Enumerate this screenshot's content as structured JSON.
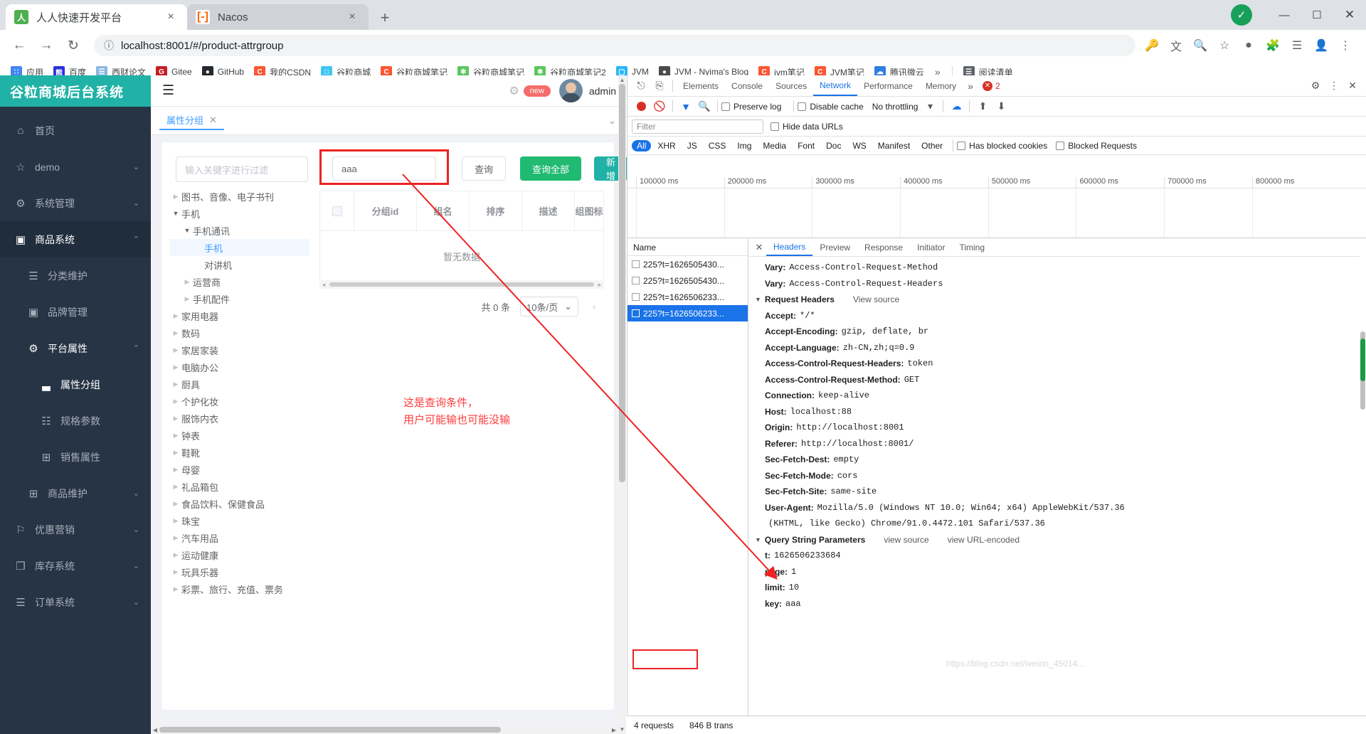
{
  "browser": {
    "tabs": [
      {
        "title": "人人快速开发平台",
        "icon": "renren-favicon",
        "active": true,
        "close": "×"
      },
      {
        "title": "Nacos",
        "icon": "nacos-favicon",
        "active": false,
        "close": "×"
      }
    ],
    "new_tab_label": "+",
    "window_controls": {
      "minimize": "—",
      "maximize": "❐",
      "close": "✕"
    },
    "toolbar": {
      "back": "←",
      "forward": "→",
      "reload": "↻",
      "site_info": "ⓘ",
      "url": "localhost:8001/#/product-attrgroup",
      "actions": [
        "key-icon",
        "translate-icon",
        "search-icon",
        "star-icon",
        "extension-puzzle-icon",
        "profile-icon",
        "menu-icon"
      ]
    },
    "bookmarks": [
      {
        "label": "应用",
        "icon": "apps-grid-icon",
        "color": "#4285f4"
      },
      {
        "label": "百度",
        "icon": "baidu-icon",
        "color": "#2932e1"
      },
      {
        "label": "西财论文",
        "icon": "doc-icon",
        "color": "#8bb7e0"
      },
      {
        "label": "Gitee",
        "icon": "gitee-icon",
        "color": "#c71d23"
      },
      {
        "label": "GitHub",
        "icon": "github-icon",
        "color": "#24292e"
      },
      {
        "label": "我的CSDN",
        "icon": "csdn-icon",
        "color": "#fc5531"
      },
      {
        "label": "谷粒商城",
        "icon": "mall-icon",
        "color": "#3fc5f0"
      },
      {
        "label": "谷粒商城笔记",
        "icon": "csdn-icon",
        "color": "#fc5531"
      },
      {
        "label": "谷粒商城笔记",
        "icon": "leaf-icon",
        "color": "#5cc75c"
      },
      {
        "label": "谷粒商城笔记2",
        "icon": "leaf-icon",
        "color": "#5cc75c"
      },
      {
        "label": "JVM",
        "icon": "robot-icon",
        "color": "#29b6f6"
      },
      {
        "label": "JVM - Nyima's Blog",
        "icon": "globe-icon",
        "color": "#4a4a4a"
      },
      {
        "label": "jvm笔记",
        "icon": "csdn-icon",
        "color": "#fc5531"
      },
      {
        "label": "JVM笔记",
        "icon": "csdn-icon",
        "color": "#fc5531"
      },
      {
        "label": "腾讯微云",
        "icon": "weiyun-icon",
        "color": "#2f7fe0"
      }
    ],
    "overflow_label": "»",
    "reading_list": {
      "label": "阅读清单",
      "icon": "reading-list-icon"
    }
  },
  "admin": {
    "brand": "谷粒商城后台系统",
    "header": {
      "hamburger": "☰",
      "gear": "⚙",
      "new_badge": "new",
      "username": "admin"
    },
    "menu": [
      {
        "label": "首页",
        "icon": "home-icon",
        "level": 1,
        "chevron": "",
        "state": ""
      },
      {
        "label": "demo",
        "icon": "star-icon",
        "level": 1,
        "chevron": "⌄",
        "state": ""
      },
      {
        "label": "系统管理",
        "icon": "gear-icon",
        "level": 1,
        "chevron": "⌄",
        "state": ""
      },
      {
        "label": "商品系统",
        "icon": "box-icon",
        "level": 1,
        "chevron": "⌃",
        "state": "group-open"
      },
      {
        "label": "分类维护",
        "icon": "list-icon",
        "level": 2,
        "chevron": "",
        "state": ""
      },
      {
        "label": "品牌管理",
        "icon": "box-icon",
        "level": 2,
        "chevron": "",
        "state": ""
      },
      {
        "label": "平台属性",
        "icon": "gear-icon",
        "level": 2,
        "chevron": "⌃",
        "state": "active"
      },
      {
        "label": "属性分组",
        "icon": "chart-icon",
        "level": 3,
        "chevron": "",
        "state": "active"
      },
      {
        "label": "规格参数",
        "icon": "file-icon",
        "level": 3,
        "chevron": "",
        "state": ""
      },
      {
        "label": "销售属性",
        "icon": "grid-icon",
        "level": 3,
        "chevron": "",
        "state": ""
      },
      {
        "label": "商品维护",
        "icon": "grid-icon",
        "level": 2,
        "chevron": "⌄",
        "state": ""
      },
      {
        "label": "优惠营销",
        "icon": "coupon-icon",
        "level": 1,
        "chevron": "⌄",
        "state": ""
      },
      {
        "label": "库存系统",
        "icon": "stock-icon",
        "level": 1,
        "chevron": "⌄",
        "state": ""
      },
      {
        "label": "订单系统",
        "icon": "order-icon",
        "level": 1,
        "chevron": "⌄",
        "state": ""
      }
    ],
    "view_tab": {
      "label": "属性分组",
      "close": "✕",
      "collapse": "⌄"
    },
    "tree_filter_placeholder": "输入关键字进行过滤",
    "tree": [
      {
        "label": "图书、音像、电子书刊",
        "level": 1,
        "arrow": "collapsed",
        "selected": false
      },
      {
        "label": "手机",
        "level": 1,
        "arrow": "expanded",
        "selected": false
      },
      {
        "label": "手机通讯",
        "level": 2,
        "arrow": "expanded",
        "selected": false
      },
      {
        "label": "手机",
        "level": 3,
        "arrow": "none",
        "selected": true
      },
      {
        "label": "对讲机",
        "level": 3,
        "arrow": "none",
        "selected": false
      },
      {
        "label": "运营商",
        "level": 2,
        "arrow": "collapsed",
        "selected": false
      },
      {
        "label": "手机配件",
        "level": 2,
        "arrow": "collapsed",
        "selected": false
      },
      {
        "label": "家用电器",
        "level": 1,
        "arrow": "collapsed",
        "selected": false
      },
      {
        "label": "数码",
        "level": 1,
        "arrow": "collapsed",
        "selected": false
      },
      {
        "label": "家居家装",
        "level": 1,
        "arrow": "collapsed",
        "selected": false
      },
      {
        "label": "电脑办公",
        "level": 1,
        "arrow": "collapsed",
        "selected": false
      },
      {
        "label": "厨具",
        "level": 1,
        "arrow": "collapsed",
        "selected": false
      },
      {
        "label": "个护化妆",
        "level": 1,
        "arrow": "collapsed",
        "selected": false
      },
      {
        "label": "服饰内衣",
        "level": 1,
        "arrow": "collapsed",
        "selected": false
      },
      {
        "label": "钟表",
        "level": 1,
        "arrow": "collapsed",
        "selected": false
      },
      {
        "label": "鞋靴",
        "level": 1,
        "arrow": "collapsed",
        "selected": false
      },
      {
        "label": "母婴",
        "level": 1,
        "arrow": "collapsed",
        "selected": false
      },
      {
        "label": "礼品箱包",
        "level": 1,
        "arrow": "collapsed",
        "selected": false
      },
      {
        "label": "食品饮料、保健食品",
        "level": 1,
        "arrow": "collapsed",
        "selected": false
      },
      {
        "label": "珠宝",
        "level": 1,
        "arrow": "collapsed",
        "selected": false
      },
      {
        "label": "汽车用品",
        "level": 1,
        "arrow": "collapsed",
        "selected": false
      },
      {
        "label": "运动健康",
        "level": 1,
        "arrow": "collapsed",
        "selected": false
      },
      {
        "label": "玩具乐器",
        "level": 1,
        "arrow": "collapsed",
        "selected": false
      },
      {
        "label": "彩票、旅行、充值、票务",
        "level": 1,
        "arrow": "collapsed",
        "selected": false
      }
    ],
    "search": {
      "value": "aaa",
      "placeholder": ""
    },
    "buttons": {
      "query": "查询",
      "query_all": "查询全部",
      "add": "新增"
    },
    "table": {
      "columns": [
        "",
        "分组id",
        "组名",
        "排序",
        "描述",
        "组图标"
      ],
      "empty_text": "暂无数据",
      "rows": []
    },
    "pagination": {
      "total": "共 0 条",
      "page_size": "10条/页",
      "prev": "‹",
      "chevron": "⌄"
    },
    "annotation_line1": "这是查询条件，",
    "annotation_line2": "用户可能输也可能没输"
  },
  "devtools": {
    "panel_tabs": [
      "Elements",
      "Console",
      "Sources",
      "Network",
      "Performance",
      "Memory"
    ],
    "active_panel": "Network",
    "more": "»",
    "error_count": "2",
    "toolbar": {
      "preserve_log": "Preserve log",
      "disable_cache": "Disable cache",
      "throttling": "No throttling",
      "filter_placeholder": "Filter",
      "hide_data_urls": "Hide data URLs"
    },
    "resource_types": [
      "All",
      "XHR",
      "JS",
      "CSS",
      "Img",
      "Media",
      "Font",
      "Doc",
      "WS",
      "Manifest",
      "Other"
    ],
    "active_resource_type": "All",
    "has_blocked_cookies": "Has blocked cookies",
    "blocked_requests": "Blocked Requests",
    "timeline_ticks": [
      "100000 ms",
      "200000 ms",
      "300000 ms",
      "400000 ms",
      "500000 ms",
      "600000 ms",
      "700000 ms",
      "800000 ms"
    ],
    "name_column_header": "Name",
    "requests": [
      {
        "name": "225?t=1626505430...",
        "selected": false
      },
      {
        "name": "225?t=1626505430...",
        "selected": false
      },
      {
        "name": "225?t=1626506233...",
        "selected": false
      },
      {
        "name": "225?t=1626506233...",
        "selected": true
      }
    ],
    "detail_tabs": [
      "Headers",
      "Preview",
      "Response",
      "Initiator",
      "Timing"
    ],
    "active_detail_tab": "Headers",
    "headers_top": [
      {
        "key": "Vary:",
        "value": "Access-Control-Request-Method"
      },
      {
        "key": "Vary:",
        "value": "Access-Control-Request-Headers"
      }
    ],
    "request_headers_section": {
      "title": "Request Headers",
      "view_source": "View source"
    },
    "request_headers": [
      {
        "key": "Accept:",
        "value": "*/*"
      },
      {
        "key": "Accept-Encoding:",
        "value": "gzip, deflate, br"
      },
      {
        "key": "Accept-Language:",
        "value": "zh-CN,zh;q=0.9"
      },
      {
        "key": "Access-Control-Request-Headers:",
        "value": "token"
      },
      {
        "key": "Access-Control-Request-Method:",
        "value": "GET"
      },
      {
        "key": "Connection:",
        "value": "keep-alive"
      },
      {
        "key": "Host:",
        "value": "localhost:88"
      },
      {
        "key": "Origin:",
        "value": "http://localhost:8001"
      },
      {
        "key": "Referer:",
        "value": "http://localhost:8001/"
      },
      {
        "key": "Sec-Fetch-Dest:",
        "value": "empty"
      },
      {
        "key": "Sec-Fetch-Mode:",
        "value": "cors"
      },
      {
        "key": "Sec-Fetch-Site:",
        "value": "same-site"
      },
      {
        "key": "User-Agent:",
        "value": "Mozilla/5.0 (Windows NT 10.0; Win64; x64) AppleWebKit/537.36"
      },
      {
        "key": "",
        "value": "(KHTML, like Gecko) Chrome/91.0.4472.101 Safari/537.36"
      }
    ],
    "query_section": {
      "title": "Query String Parameters",
      "view_source": "view source",
      "view_url_encoded": "view URL-encoded"
    },
    "query_params": [
      {
        "key": "t:",
        "value": "1626506233684"
      },
      {
        "key": "page:",
        "value": "1"
      },
      {
        "key": "limit:",
        "value": "10"
      },
      {
        "key": "key:",
        "value": "aaa"
      }
    ],
    "status": {
      "requests": "4 requests",
      "transferred": "846 B trans"
    }
  },
  "watermark": "https://blog.csdn.net/weixin_45014...",
  "colors": {
    "brand_teal": "#20b2a6",
    "sidebar_bg": "#263445",
    "accent_blue": "#409eff",
    "devtools_blue": "#1a73e8",
    "highlight_red": "#ee2222",
    "green_button": "#21ba72"
  }
}
